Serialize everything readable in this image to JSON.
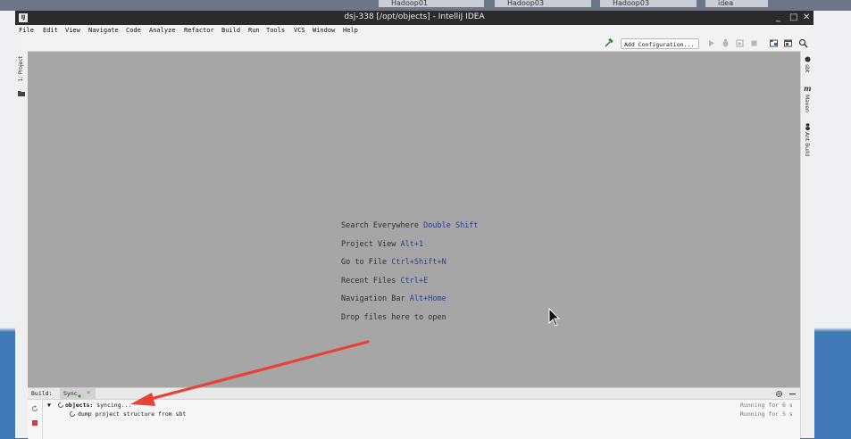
{
  "desktop": {
    "tabs": [
      "Hadoop01",
      "Hadoop03",
      "Hadoop03",
      "idea"
    ]
  },
  "window": {
    "logo": "IJ",
    "title": "dsj-338 [/opt/objects] - IntelliJ IDEA",
    "controls": {
      "minimize": "_",
      "maximize": "□",
      "close": "✕"
    }
  },
  "menu": [
    "File",
    "Edit",
    "View",
    "Navigate",
    "Code",
    "Analyze",
    "Refactor",
    "Build",
    "Run",
    "Tools",
    "VCS",
    "Window",
    "Help"
  ],
  "toolbar": {
    "run_config": "Add Configuration...",
    "icons": [
      "hammer-icon",
      "run-icon",
      "debug-icon",
      "coverage-icon",
      "stop-icon",
      "project-structure-icon",
      "layout-icon",
      "search-icon"
    ]
  },
  "left_stripe": {
    "project_label": "1: Project"
  },
  "right_stripe": {
    "sbt_label": "sbt",
    "maven_label": "Maven",
    "ant_label": "Ant Build"
  },
  "editor": {
    "hints": [
      {
        "text": "Search Everywhere",
        "shortcut": "Double Shift"
      },
      {
        "text": "Project View",
        "shortcut": "Alt+1"
      },
      {
        "text": "Go to File",
        "shortcut": "Ctrl+Shift+N"
      },
      {
        "text": "Recent Files",
        "shortcut": "Ctrl+E"
      },
      {
        "text": "Navigation Bar",
        "shortcut": "Alt+Home"
      },
      {
        "text": "Drop files here to open",
        "shortcut": ""
      }
    ]
  },
  "build": {
    "label": "Build:",
    "tab": "Sync",
    "tab_close": "×",
    "rows": [
      {
        "name": "objects:",
        "status": "syncing...",
        "time": "Running for 6 s"
      },
      {
        "name": "dump project structure from sbt",
        "status": "",
        "time": "Running for 5 s"
      }
    ]
  },
  "colors": {
    "annotation_arrow": "#e8413a",
    "editor_bg": "#a6a6a6",
    "shortcut": "#2a3f8f"
  }
}
